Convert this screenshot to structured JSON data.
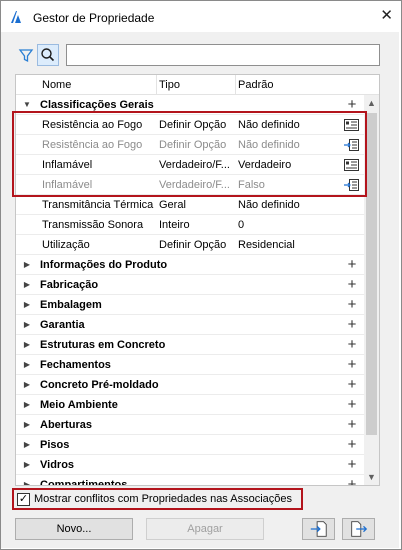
{
  "window": {
    "title": "Gestor de Propriedade",
    "close_glyph": "✕"
  },
  "toolbar": {
    "filter_icon": "filter-icon",
    "search_icon": "search-icon",
    "search_value": ""
  },
  "columns": {
    "name": "Nome",
    "type": "Tipo",
    "default": "Padrão"
  },
  "rows": [
    {
      "kind": "group",
      "label": "Classificações Gerais",
      "expanded": true
    },
    {
      "kind": "prop",
      "name": "Resistência ao Fogo",
      "type": "Definir Opção",
      "default": "Não definido",
      "dim": false,
      "icon": "properties-icon"
    },
    {
      "kind": "prop",
      "name": "Resistência ao Fogo",
      "type": "Definir Opção",
      "default": "Não definido",
      "dim": true,
      "icon": "import-icon"
    },
    {
      "kind": "prop",
      "name": "Inflamável",
      "type": "Verdadeiro/F...",
      "default": "Verdadeiro",
      "dim": false,
      "icon": "properties-icon"
    },
    {
      "kind": "prop",
      "name": "Inflamável",
      "type": "Verdadeiro/F...",
      "default": "Falso",
      "dim": true,
      "icon": "import-icon"
    },
    {
      "kind": "prop",
      "name": "Transmitância Térmica",
      "type": "Geral",
      "default": "Não definido",
      "dim": false
    },
    {
      "kind": "prop",
      "name": "Transmissão Sonora",
      "type": "Inteiro",
      "default": "0",
      "dim": false
    },
    {
      "kind": "prop",
      "name": "Utilização",
      "type": "Definir Opção",
      "default": "Residencial",
      "dim": false
    },
    {
      "kind": "group",
      "label": "Informações do Produto",
      "expanded": false
    },
    {
      "kind": "group",
      "label": "Fabricação",
      "expanded": false
    },
    {
      "kind": "group",
      "label": "Embalagem",
      "expanded": false
    },
    {
      "kind": "group",
      "label": "Garantia",
      "expanded": false
    },
    {
      "kind": "group",
      "label": "Estruturas em Concreto",
      "expanded": false
    },
    {
      "kind": "group",
      "label": "Fechamentos",
      "expanded": false
    },
    {
      "kind": "group",
      "label": "Concreto Pré-moldado",
      "expanded": false
    },
    {
      "kind": "group",
      "label": "Meio Ambiente",
      "expanded": false
    },
    {
      "kind": "group",
      "label": "Aberturas",
      "expanded": false
    },
    {
      "kind": "group",
      "label": "Pisos",
      "expanded": false
    },
    {
      "kind": "group",
      "label": "Vidros",
      "expanded": false
    },
    {
      "kind": "group",
      "label": "Compartimentos",
      "expanded": false
    }
  ],
  "options": {
    "show_conflicts_label": "Mostrar conflitos com Propriedades nas Associações",
    "show_conflicts_checked": true
  },
  "buttons": {
    "new_label": "Novo...",
    "delete_label": "Apagar",
    "import_icon": "import-icon",
    "export_icon": "export-icon"
  },
  "colors": {
    "highlight": "#b3141c",
    "search_active": "#dcecfc",
    "filter_icon": "#2a7fd4"
  }
}
